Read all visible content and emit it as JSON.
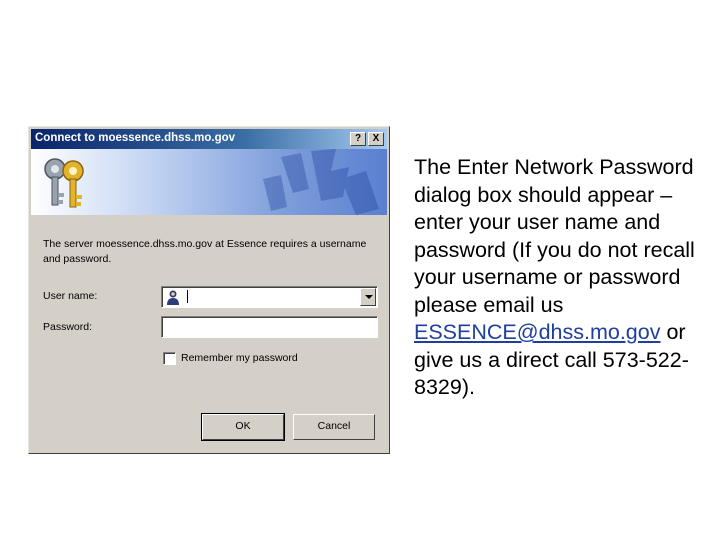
{
  "dialog": {
    "title": "Connect to moessence.dhss.mo.gov",
    "help_button": "?",
    "close_button": "X",
    "prompt": "The server moessence.dhss.mo.gov at Essence requires a username and password.",
    "user_label": "User name:",
    "user_value": "",
    "password_label": "Password:",
    "password_value": "",
    "remember_label": "Remember my password",
    "remember_checked": false,
    "ok_label": "OK",
    "cancel_label": "Cancel",
    "icons": [
      "keys-icon",
      "user-avatar-icon",
      "chevron-down-icon"
    ]
  },
  "side": {
    "text_before": "The Enter Network Password dialog box should appear – enter your user name and password (If you do not recall your username or password please email us ",
    "email": "ESSENCE@dhss.mo.gov",
    "text_after": " or give us a direct call 573-522-8329)."
  },
  "colors": {
    "title_bar": "#0a246a",
    "dialog_bg": "#d4d0c8",
    "link": "#1f3f9f"
  }
}
